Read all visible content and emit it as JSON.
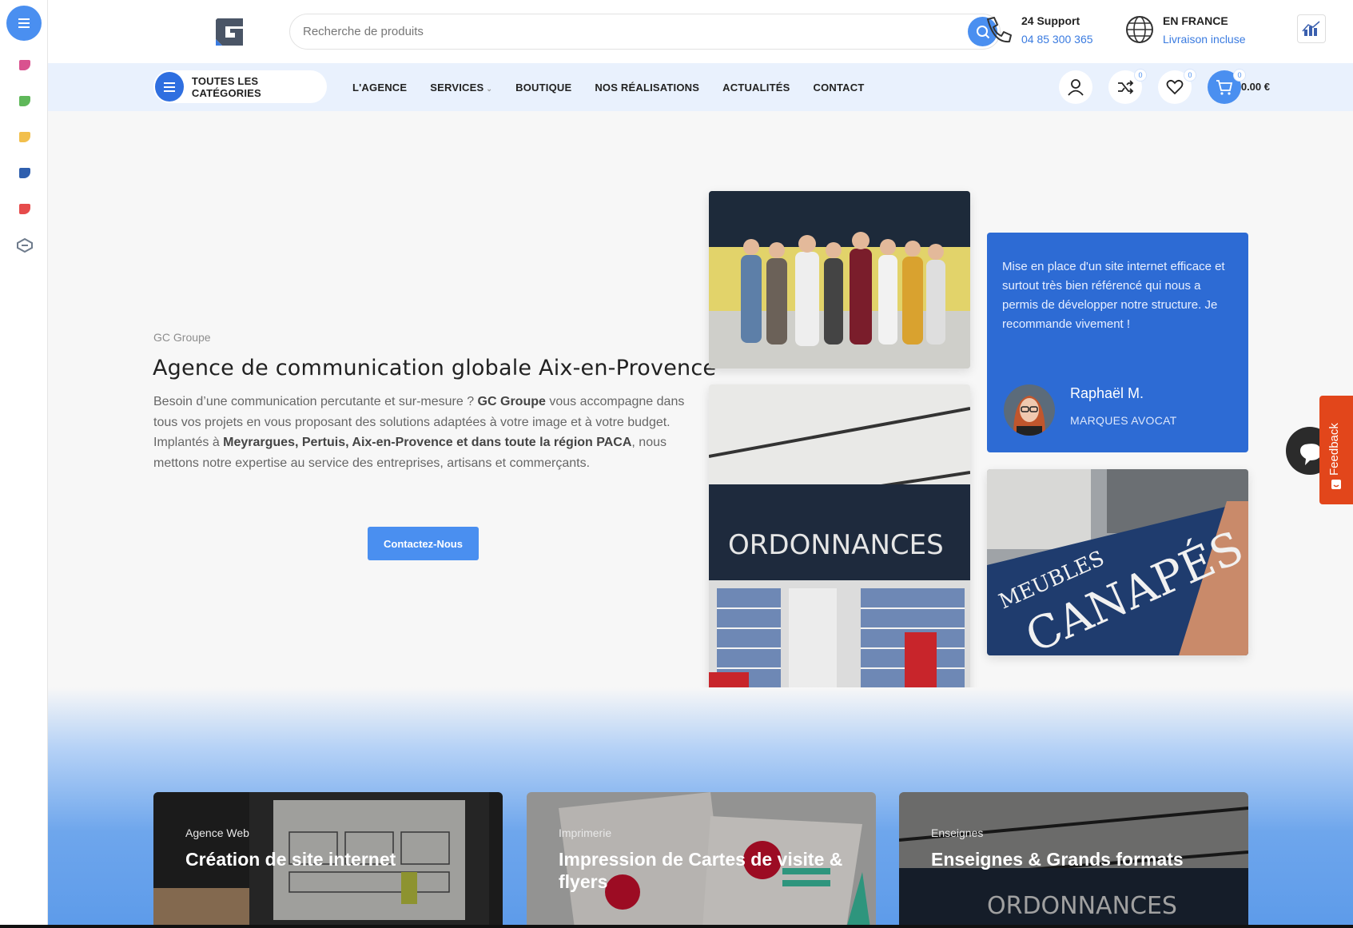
{
  "header": {
    "search_placeholder": "Recherche de produits",
    "support": {
      "title": "24 Support",
      "phone": "04 85 300 365"
    },
    "shipping": {
      "title": "EN FRANCE",
      "subtitle": "Livraison incluse"
    }
  },
  "nav": {
    "categories_label": "TOUTES LES CATÉGORIES",
    "links": [
      "L'AGENCE",
      "SERVICES",
      "BOUTIQUE",
      "NOS RÉALISATIONS",
      "ACTUALITÉS",
      "CONTACT"
    ],
    "compare_count": "0",
    "wishlist_count": "0",
    "cart_count": "0",
    "cart_total": "0.00 €"
  },
  "hero": {
    "eyebrow": "GC Groupe",
    "title": "Agence de communication globale Aix-en-Provence",
    "text_1": "Besoin d’une communication percutante et sur-mesure ? ",
    "text_brand": "GC Groupe",
    "text_2": " vous accompagne dans tous vos projets en vous proposant des solutions adaptées à votre image et à votre budget. Implantés à ",
    "text_places": "Meyrargues, Pertuis, Aix-en-Provence et dans toute la région PACA",
    "text_3": ", nous mettons notre expertise au service des entreprises, artisans et commerçants.",
    "cta_label": "Contactez-Nous"
  },
  "testimonial": {
    "quote": "Mise en place d'un site internet efficace et surtout très bien référencé qui nous a permis de développer notre structure. Je recommande vivement !",
    "name": "Raphaël M.",
    "company": "MARQUES AVOCAT"
  },
  "images": {
    "pharmacy_sign": "ORDONNANCES",
    "sign_line_1": "MEUBLES",
    "sign_line_2": "CANAPÉS"
  },
  "services": [
    {
      "category": "Agence Web",
      "title": "Création de site internet"
    },
    {
      "category": "Imprimerie",
      "title": "Impression de Cartes de visite & flyers"
    },
    {
      "category": "Enseignes",
      "title": "Enseignes & Grands formats"
    }
  ],
  "feedback_label": "Feedback",
  "colors": {
    "accent": "#4a8ff0",
    "testimonial_bg": "#2d6bd4",
    "feedback": "#e2461b"
  }
}
